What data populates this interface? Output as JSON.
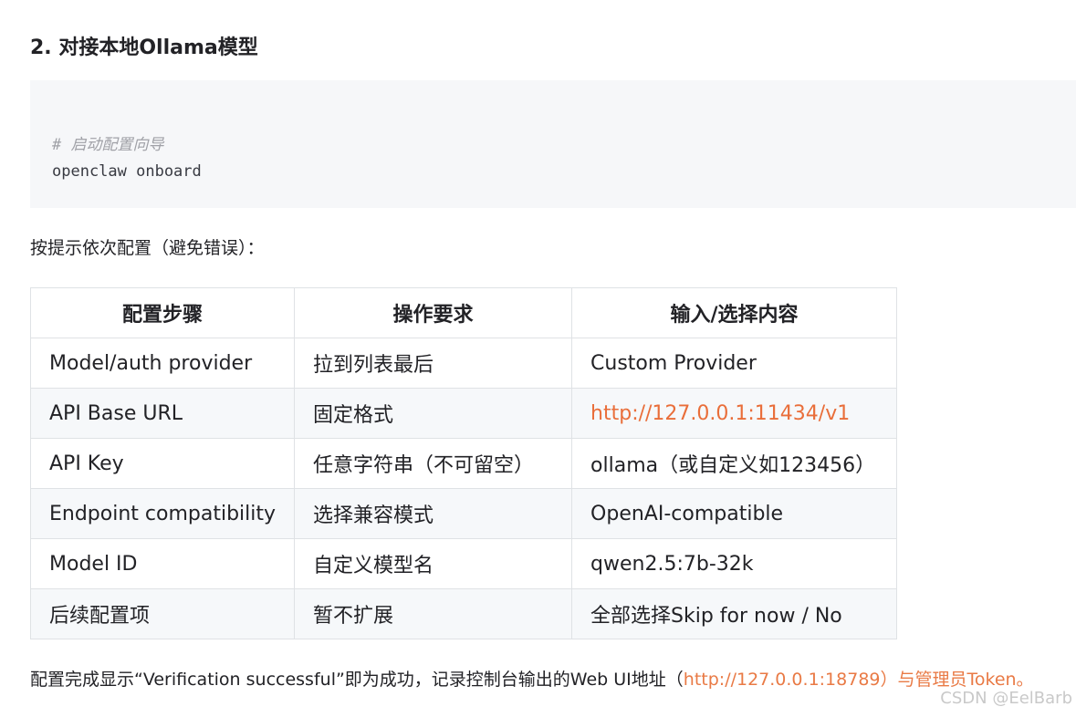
{
  "heading": "2. 对接本地Ollama模型",
  "code": {
    "comment": "# 启动配置向导",
    "command": "openclaw onboard"
  },
  "intro": "按提示依次配置（避免错误）：",
  "table": {
    "headers": [
      "配置步骤",
      "操作要求",
      "输入/选择内容"
    ],
    "rows": [
      [
        "Model/auth provider",
        "拉到列表最后",
        "Custom Provider"
      ],
      [
        "API Base URL",
        "固定格式",
        "http://127.0.0.1:11434/v1"
      ],
      [
        "API Key",
        "任意字符串（不可留空）",
        "ollama（或自定义如123456）"
      ],
      [
        "Endpoint compatibility",
        "选择兼容模式",
        "OpenAI-compatible"
      ],
      [
        "Model ID",
        "自定义模型名",
        "qwen2.5:7b-32k"
      ],
      [
        "后续配置项",
        "暂不扩展",
        "全部选择Skip for now / No"
      ]
    ]
  },
  "footer": {
    "text_before": "配置完成显示“Verification successful”即为成功，记录控制台输出的Web UI地址（",
    "link": "http://127.0.0.1:18789）与管理员Token。"
  },
  "watermark": "CSDN @EelBarb",
  "colors": {
    "link": "#e96e3a",
    "code_bg": "#f6f7f9",
    "table_border": "#dfe2e5",
    "row_alt_bg": "#f6f8fa"
  }
}
